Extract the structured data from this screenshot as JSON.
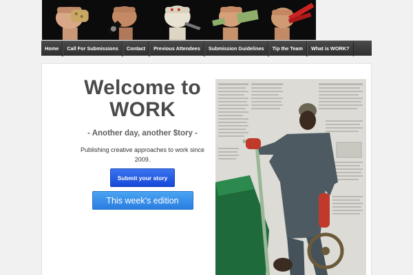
{
  "banner": {
    "panels": [
      "fist-bread",
      "fist-watch",
      "fist-glove-knife",
      "fist-money",
      "fist-pliers"
    ]
  },
  "nav": {
    "items": [
      "Home",
      "Call For Submissions",
      "Contact",
      "Previous Attendees",
      "Submission Guidelines",
      "Tip the Team",
      "What is WORK?"
    ]
  },
  "main": {
    "welcome_line1": "Welcome to",
    "welcome_line2": "WORK",
    "tagline": "- Another day, another $tory -",
    "description": "Publishing creative approaches to work since 2009.",
    "submit_button": "Submit your story",
    "edition_button": "This week's edition"
  },
  "colors": {
    "nav_bg": "#333333",
    "submit_button": "#1f56e0",
    "edition_button": "#3a91ea",
    "heading": "#4a4a4a"
  }
}
